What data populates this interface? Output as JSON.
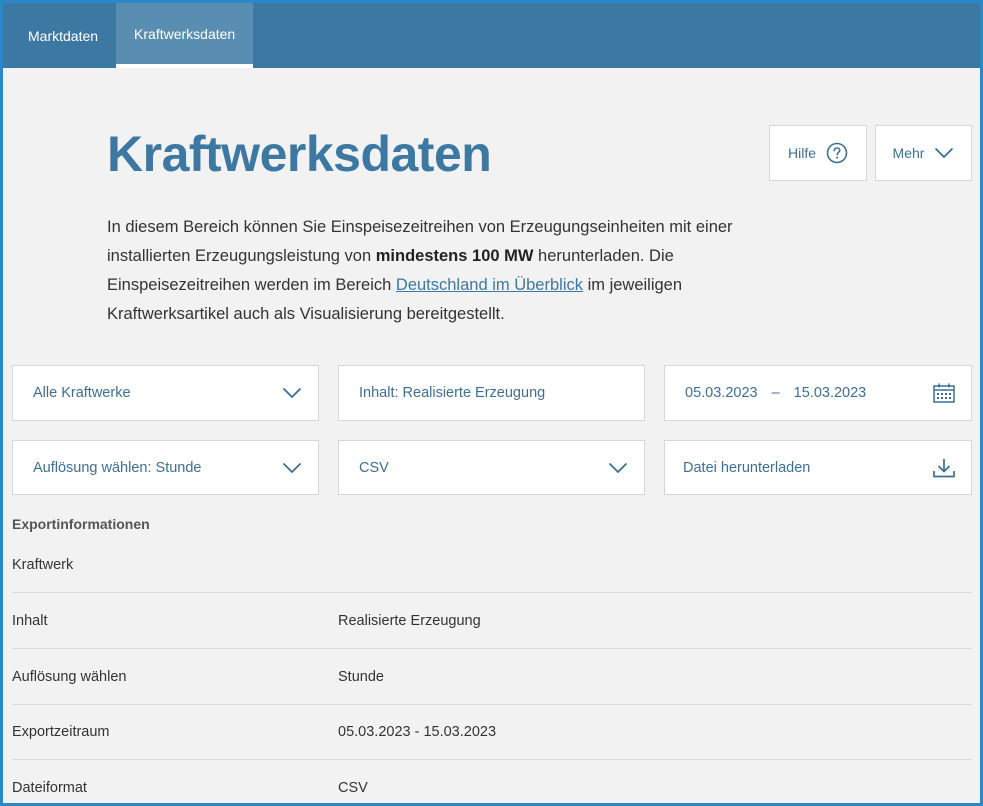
{
  "nav": {
    "tabs": [
      {
        "label": "Marktdaten",
        "active": false
      },
      {
        "label": "Kraftwerksdaten",
        "active": true
      }
    ]
  },
  "header": {
    "title": "Kraftwerksdaten",
    "help_label": "Hilfe",
    "help_icon": "question-circle-icon",
    "more_label": "Mehr",
    "more_icon": "chevron-down-icon"
  },
  "intro": {
    "part1": "In diesem Bereich können Sie Einspeisezeitreihen von Erzeugungseinheiten mit einer installierten Erzeugungsleistung von ",
    "bold": "mindestens 100 MW",
    "part2": " herunterladen. Die Einspeisezeitreihen werden im Bereich ",
    "link": "Deutschland im Überblick",
    "part3": " im jeweiligen Kraftwerksartikel auch als Visualisierung bereitgestellt."
  },
  "filters": {
    "plant_select": "Alle Kraftwerke",
    "content_select": "Inhalt: Realisierte Erzeugung",
    "date_from": "05.03.2023",
    "date_separator": "–",
    "date_to": "15.03.2023",
    "resolution_select": "Auflösung wählen: Stunde",
    "format_select": "CSV",
    "download_label": "Datei herunterladen"
  },
  "export": {
    "heading": "Exportinformationen",
    "rows": [
      {
        "label": "Kraftwerk",
        "value": ""
      },
      {
        "label": "Inhalt",
        "value": "Realisierte Erzeugung"
      },
      {
        "label": "Auflösung wählen",
        "value": "Stunde"
      },
      {
        "label": "Exportzeitraum",
        "value": "05.03.2023 - 15.03.2023"
      },
      {
        "label": "Dateiformat",
        "value": "CSV"
      }
    ]
  },
  "colors": {
    "nav_bg": "#3d78a3",
    "accent": "#3d78a3",
    "page_bg": "#f2f2f2"
  }
}
